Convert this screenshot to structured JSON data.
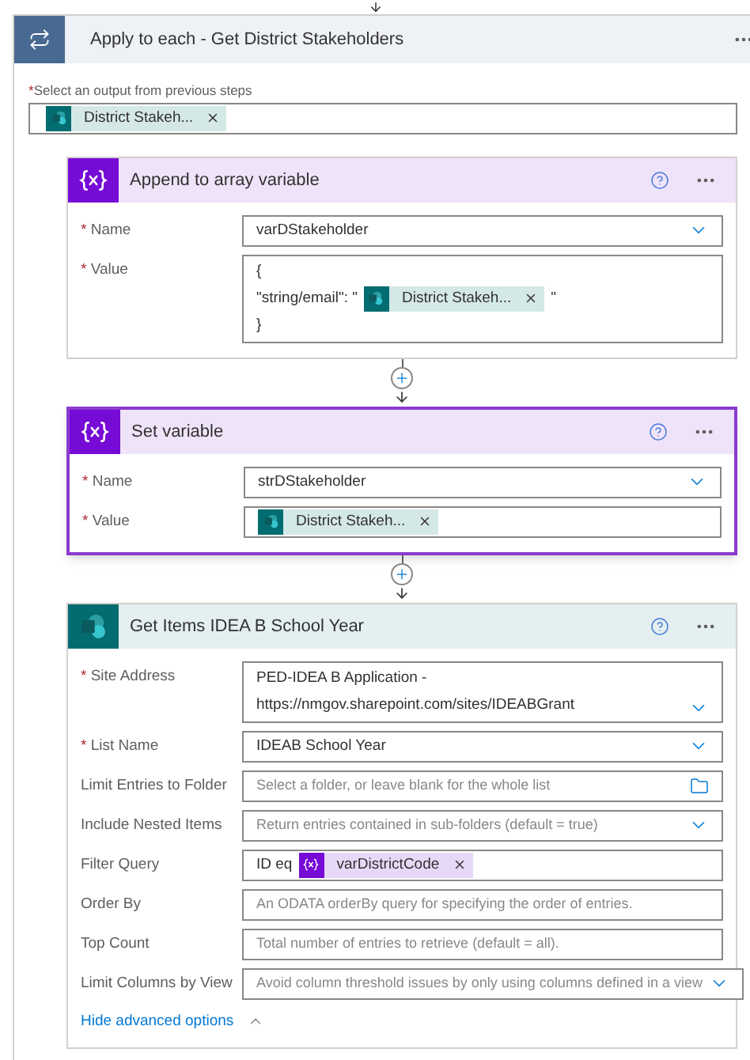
{
  "loop": {
    "title": "Apply to each - Get District Stakeholders",
    "output_marker": "*",
    "output_label": "Select an output from previous steps",
    "output_tokens": [
      {
        "kind": "sharepoint",
        "label": "District Stakeh..."
      }
    ]
  },
  "cards": [
    {
      "kind": "variable",
      "title": "Append to array variable",
      "selected": false,
      "fields": [
        {
          "marker": "*",
          "label": "Name",
          "kind": "dropdown",
          "lines": [
            [
              {
                "kind": "text",
                "text": "varDStakeholder"
              }
            ]
          ]
        },
        {
          "marker": "*",
          "label": "Value",
          "kind": "input",
          "lines": [
            [
              {
                "kind": "text",
                "text": "{"
              }
            ],
            [
              {
                "kind": "text",
                "text": "\"string/email\": \""
              },
              {
                "kind": "sharepoint",
                "label": "District Stakeh..."
              },
              {
                "kind": "text",
                "text": "\""
              }
            ],
            [
              {
                "kind": "text",
                "text": "}"
              }
            ]
          ]
        }
      ]
    },
    {
      "kind": "variable",
      "title": "Set variable",
      "selected": true,
      "fields": [
        {
          "marker": "*",
          "label": "Name",
          "kind": "dropdown",
          "lines": [
            [
              {
                "kind": "text",
                "text": "strDStakeholder"
              }
            ]
          ]
        },
        {
          "marker": "*",
          "label": "Value",
          "kind": "input",
          "lines": [
            [
              {
                "kind": "sharepoint",
                "label": "District Stakeh..."
              }
            ]
          ]
        }
      ]
    },
    {
      "kind": "sharepoint",
      "title": "Get Items IDEA B School Year",
      "selected": false,
      "fields": [
        {
          "marker": "*",
          "label": "Site Address",
          "kind": "dropdown",
          "lines": [
            [
              {
                "kind": "text",
                "text": "PED-IDEA B Application -"
              }
            ],
            [
              {
                "kind": "text",
                "text": "https://nmgov.sharepoint.com/sites/IDEABGrant"
              }
            ]
          ]
        },
        {
          "marker": "*",
          "label": "List Name",
          "kind": "dropdown",
          "lines": [
            [
              {
                "kind": "text",
                "text": "IDEAB School Year"
              }
            ]
          ]
        },
        {
          "label": "Limit Entries to Folder",
          "kind": "folder",
          "placeholder": "Select a folder, or leave blank for the whole list"
        },
        {
          "label": "Include Nested Items",
          "kind": "dropdown",
          "placeholder": "Return entries contained in sub-folders (default = true)"
        },
        {
          "label": "Filter Query",
          "kind": "input",
          "lines": [
            [
              {
                "kind": "text",
                "text": "ID eq"
              },
              {
                "kind": "variable",
                "label": "varDistrictCode"
              }
            ]
          ]
        },
        {
          "label": "Order By",
          "kind": "input",
          "placeholder": "An ODATA orderBy query for specifying the order of entries."
        },
        {
          "label": "Top Count",
          "kind": "input",
          "placeholder": "Total number of entries to retrieve (default = all)."
        },
        {
          "label": "Limit Columns by View",
          "kind": "dropdown",
          "placeholder": "Avoid column threshold issues by only using columns defined in a view"
        }
      ],
      "advanced_link": "Hide advanced options"
    }
  ]
}
